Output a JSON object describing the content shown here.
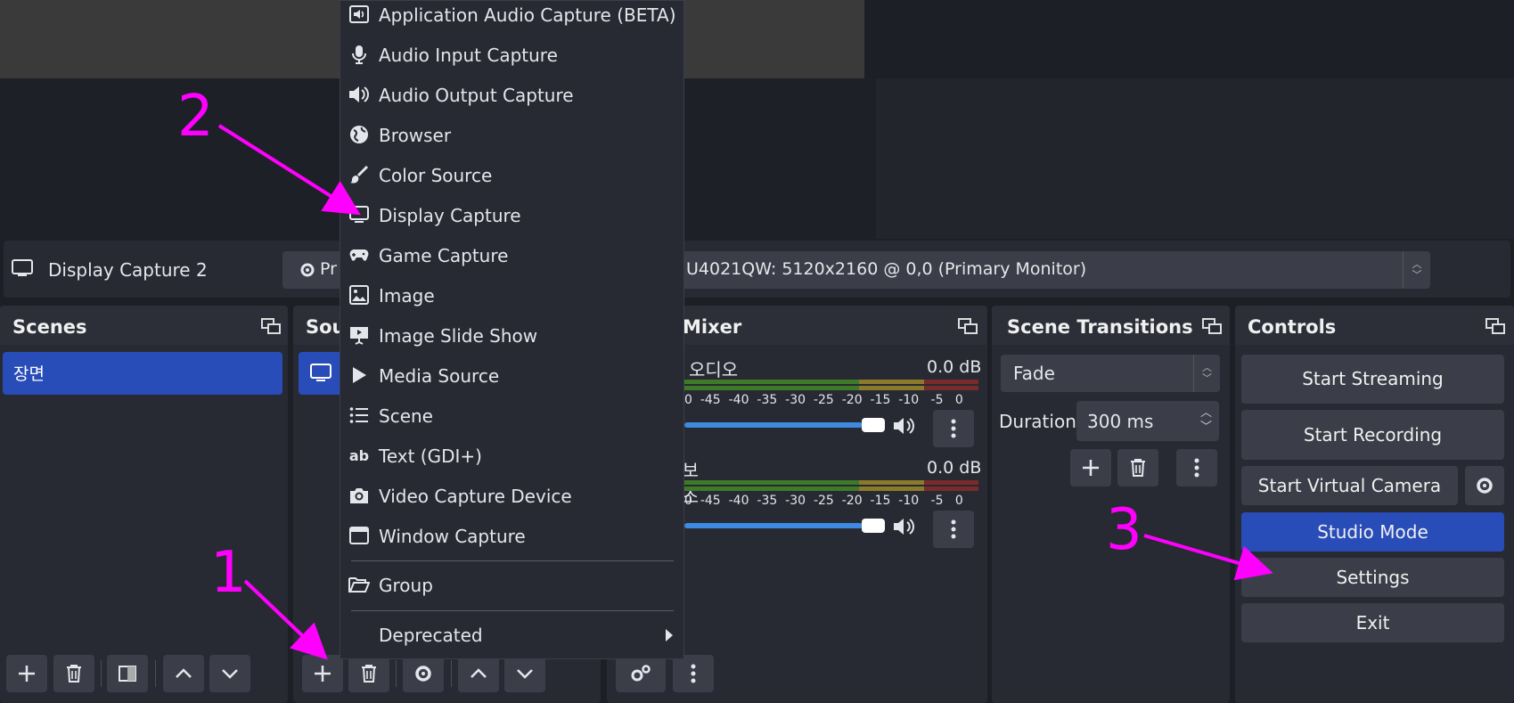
{
  "context_bar": {
    "source_name": "Display Capture 2",
    "properties_label": "Pr",
    "monitor_value": "U4021QW: 5120x2160 @ 0,0 (Primary Monitor)"
  },
  "scenes": {
    "title": "Scenes",
    "items": [
      "장면"
    ]
  },
  "sources": {
    "title": "Sou"
  },
  "mixer": {
    "title": "Mixer",
    "channels": [
      {
        "label": "오디오",
        "db": "0.0 dB"
      },
      {
        "label": "보조",
        "db": "0.0 dB"
      }
    ],
    "tick_labels": [
      "0",
      "-45",
      "-40",
      "-35",
      "-30",
      "-25",
      "-20",
      "-15",
      "-10",
      "-5",
      "0"
    ]
  },
  "transitions": {
    "title": "Scene Transitions",
    "transition": "Fade",
    "duration_label": "Duration",
    "duration_value": "300 ms"
  },
  "controls": {
    "title": "Controls",
    "start_streaming": "Start Streaming",
    "start_recording": "Start Recording",
    "start_virtual_camera": "Start Virtual Camera",
    "studio_mode": "Studio Mode",
    "settings": "Settings",
    "exit": "Exit"
  },
  "add_source_menu": {
    "items": [
      {
        "label": "Application Audio Capture (BETA)",
        "icon": "app-audio-icon"
      },
      {
        "label": "Audio Input Capture",
        "icon": "microphone-icon"
      },
      {
        "label": "Audio Output Capture",
        "icon": "speaker-icon"
      },
      {
        "label": "Browser",
        "icon": "globe-icon"
      },
      {
        "label": "Color Source",
        "icon": "brush-icon"
      },
      {
        "label": "Display Capture",
        "icon": "monitor-icon"
      },
      {
        "label": "Game Capture",
        "icon": "gamepad-icon"
      },
      {
        "label": "Image",
        "icon": "image-icon"
      },
      {
        "label": "Image Slide Show",
        "icon": "slideshow-icon"
      },
      {
        "label": "Media Source",
        "icon": "play-icon"
      },
      {
        "label": "Scene",
        "icon": "list-icon"
      },
      {
        "label": "Text (GDI+)",
        "icon": "text-icon"
      },
      {
        "label": "Video Capture Device",
        "icon": "camera-icon"
      },
      {
        "label": "Window Capture",
        "icon": "window-icon"
      }
    ],
    "group": "Group",
    "deprecated": "Deprecated"
  },
  "annotations": {
    "step1": "1",
    "step2": "2",
    "step3": "3",
    "color": "#ff00ff"
  },
  "colors": {
    "accent": "#284cb8",
    "background": "#1d1f26",
    "panel": "#272a33",
    "button": "#3b3e48"
  }
}
